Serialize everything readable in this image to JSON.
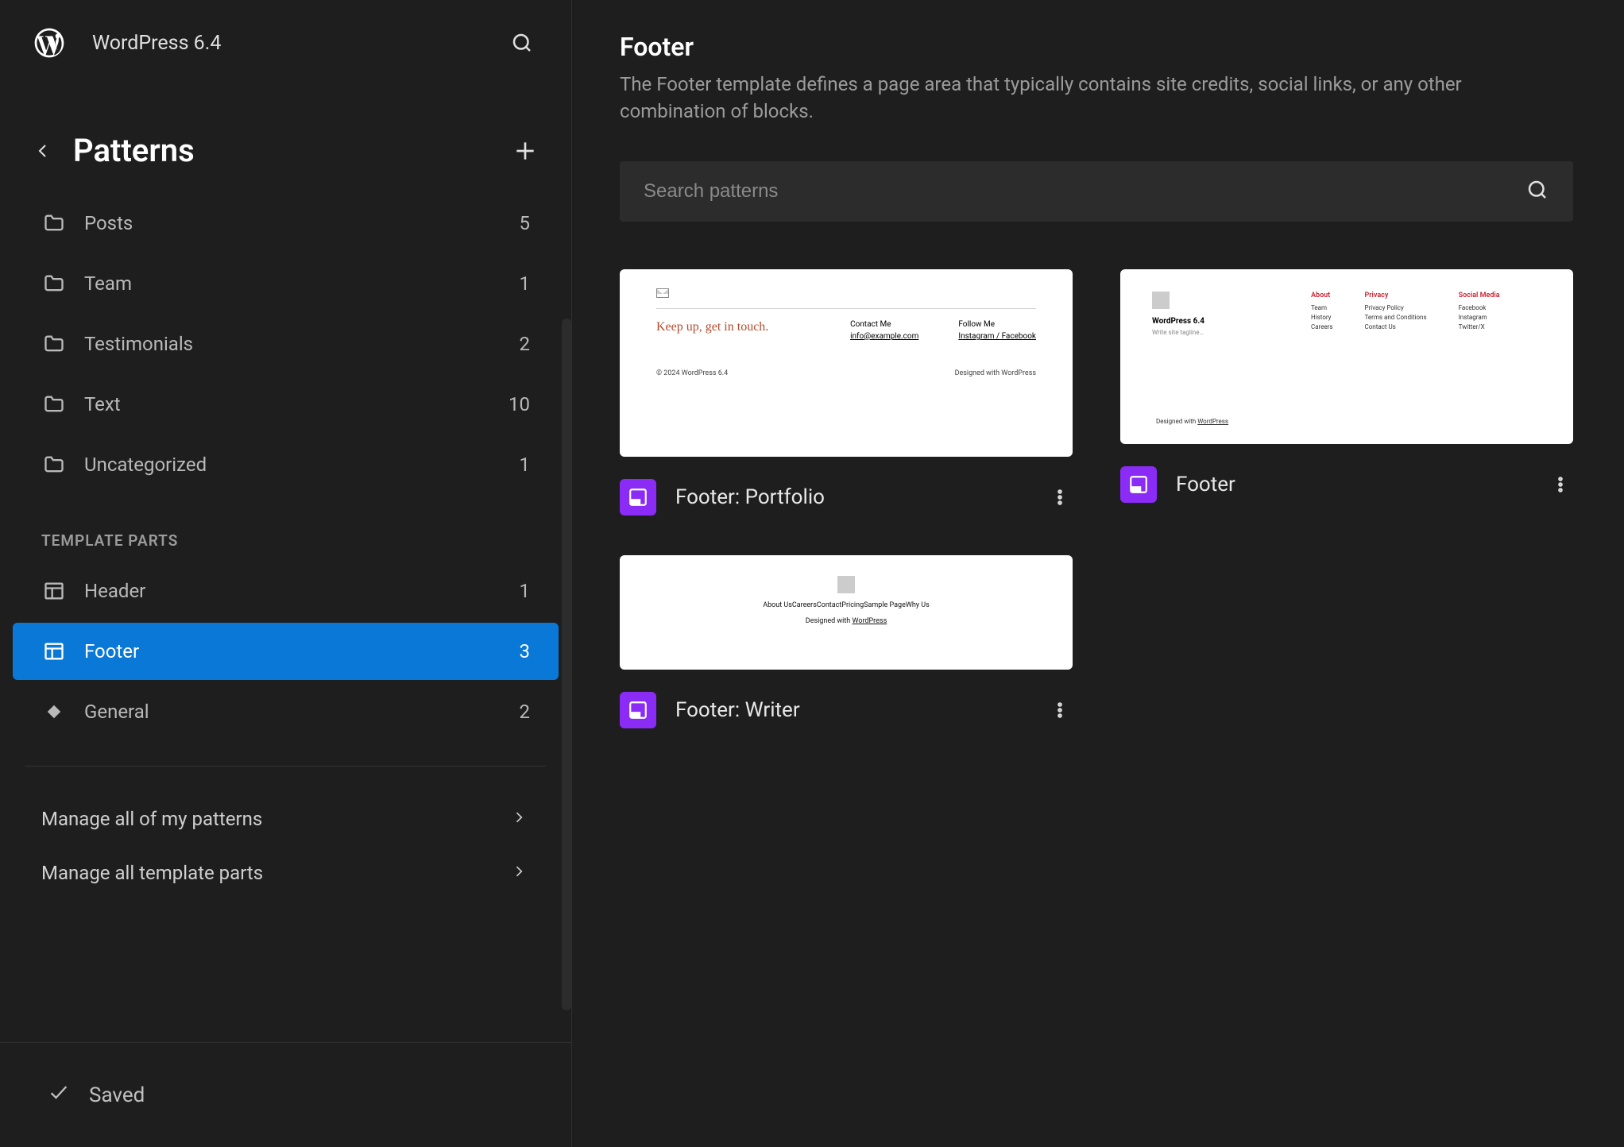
{
  "header": {
    "site_title": "WordPress 6.4"
  },
  "sidebar": {
    "section_title": "Patterns",
    "categories": [
      {
        "label": "Posts",
        "count": "5"
      },
      {
        "label": "Team",
        "count": "1"
      },
      {
        "label": "Testimonials",
        "count": "2"
      },
      {
        "label": "Text",
        "count": "10"
      },
      {
        "label": "Uncategorized",
        "count": "1"
      }
    ],
    "template_parts_label": "TEMPLATE PARTS",
    "template_parts": [
      {
        "label": "Header",
        "count": "1",
        "active": false,
        "icon": "layout"
      },
      {
        "label": "Footer",
        "count": "3",
        "active": true,
        "icon": "layout"
      },
      {
        "label": "General",
        "count": "2",
        "active": false,
        "icon": "diamond"
      }
    ],
    "manage_patterns": "Manage all of my patterns",
    "manage_template_parts": "Manage all template parts"
  },
  "status": {
    "saved": "Saved"
  },
  "main": {
    "title": "Footer",
    "description": "The Footer template defines a page area that typically contains site credits, social links, or any other combination of blocks.",
    "search_placeholder": "Search patterns",
    "cards": [
      {
        "title": "Footer: Portfolio"
      },
      {
        "title": "Footer"
      },
      {
        "title": "Footer: Writer"
      }
    ],
    "preview1": {
      "headline": "Keep up, get in touch.",
      "col1_title": "Contact Me",
      "col1_link": "info@example.com",
      "col2_title": "Follow Me",
      "col2_links": "Instagram / Facebook",
      "foot_left": "© 2024 WordPress 6.4",
      "foot_right": "Designed with WordPress"
    },
    "preview2": {
      "brand": "WordPress 6.4",
      "tagline": "Write site tagline…",
      "cols": [
        {
          "hd": "About",
          "lines": [
            "Team",
            "History",
            "Careers"
          ]
        },
        {
          "hd": "Privacy",
          "lines": [
            "Privacy Policy",
            "Terms and Conditions",
            "Contact Us"
          ]
        },
        {
          "hd": "Social Media",
          "lines": [
            "Facebook",
            "Instagram",
            "Twitter/X"
          ]
        }
      ],
      "foot": "Designed with WordPress"
    },
    "preview3": {
      "links": "About UsCareersContactPricingSample PageWhy Us",
      "foot": "Designed with WordPress"
    }
  }
}
